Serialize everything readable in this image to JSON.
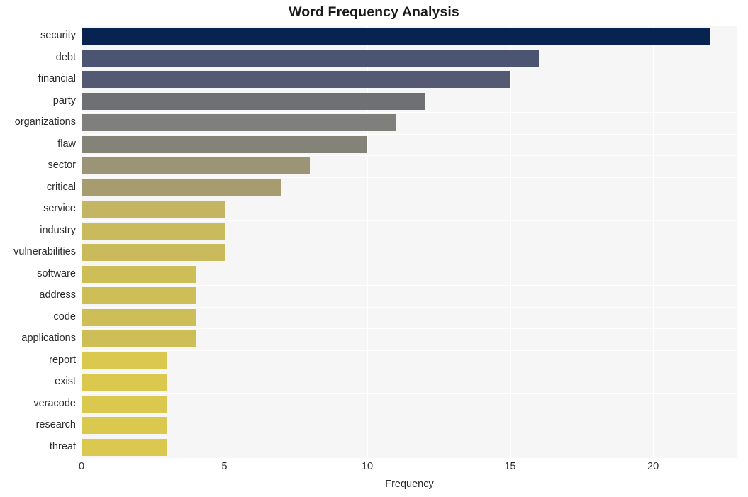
{
  "chart_data": {
    "type": "bar",
    "orientation": "horizontal",
    "title": "Word Frequency Analysis",
    "xlabel": "Frequency",
    "ylabel": "",
    "xlim": [
      0,
      22.95
    ],
    "xticks": [
      0,
      5,
      10,
      15,
      20
    ],
    "xtick_labels": [
      "0",
      "5",
      "10",
      "15",
      "20"
    ],
    "grid": true,
    "grid_color": "#ffffff",
    "plot_background": "#f6f6f7",
    "legend": null,
    "categories": [
      "security",
      "debt",
      "financial",
      "party",
      "organizations",
      "flaw",
      "sector",
      "critical",
      "service",
      "industry",
      "vulnerabilities",
      "software",
      "address",
      "code",
      "applications",
      "report",
      "exist",
      "veracode",
      "research",
      "threat"
    ],
    "values": [
      22,
      16,
      15,
      12,
      11,
      10,
      8,
      7,
      5,
      5,
      5,
      4,
      4,
      4,
      4,
      3,
      3,
      3,
      3,
      3
    ],
    "bar_colors": [
      "#06244f",
      "#4b5470",
      "#545a73",
      "#6e7074",
      "#7f7f7c",
      "#848377",
      "#9b9475",
      "#a69c70",
      "#c3b561",
      "#c9ba5c",
      "#c9ba5c",
      "#cebe58",
      "#cebe58",
      "#cebe58",
      "#cebe58",
      "#dbc84f",
      "#dbc84f",
      "#dbc84f",
      "#dbc84f",
      "#dbc84f"
    ]
  }
}
